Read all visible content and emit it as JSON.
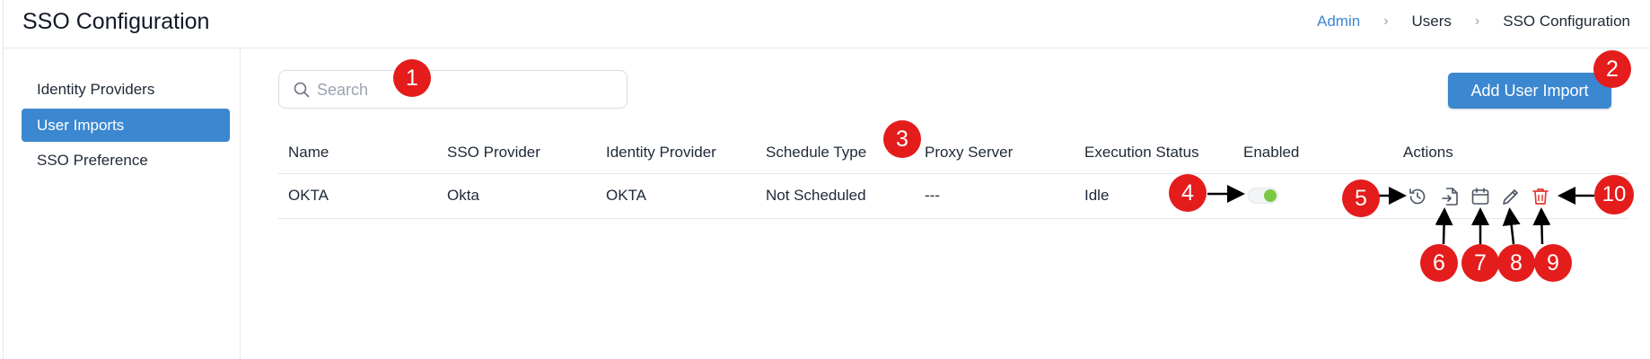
{
  "header": {
    "title": "SSO Configuration",
    "breadcrumb": [
      "Admin",
      "Users",
      "SSO Configuration"
    ],
    "separator": "›"
  },
  "sidebar": {
    "items": [
      {
        "label": "Identity Providers",
        "active": false
      },
      {
        "label": "User Imports",
        "active": true
      },
      {
        "label": "SSO Preference",
        "active": false
      }
    ]
  },
  "search": {
    "placeholder": "Search",
    "value": ""
  },
  "add_button": {
    "label": "Add User Import"
  },
  "table": {
    "columns": [
      "Name",
      "SSO Provider",
      "Identity Provider",
      "Schedule Type",
      "Proxy Server",
      "Execution Status",
      "Enabled",
      "Actions"
    ],
    "rows": [
      {
        "name": "OKTA",
        "sso_provider": "Okta",
        "identity_provider": "OKTA",
        "schedule_type": "Not Scheduled",
        "proxy_server": "---",
        "execution_status": "Idle",
        "enabled": true
      }
    ],
    "actions": [
      "history-icon",
      "import-icon",
      "calendar-icon",
      "edit-icon",
      "delete-icon"
    ]
  },
  "annotations": [
    "1",
    "2",
    "3",
    "4",
    "5",
    "6",
    "7",
    "8",
    "9",
    "10"
  ],
  "colors": {
    "accent": "#3b87d0",
    "danger": "#e53935",
    "toggle_on": "#7ac943",
    "annotation": "#e41c1c"
  }
}
